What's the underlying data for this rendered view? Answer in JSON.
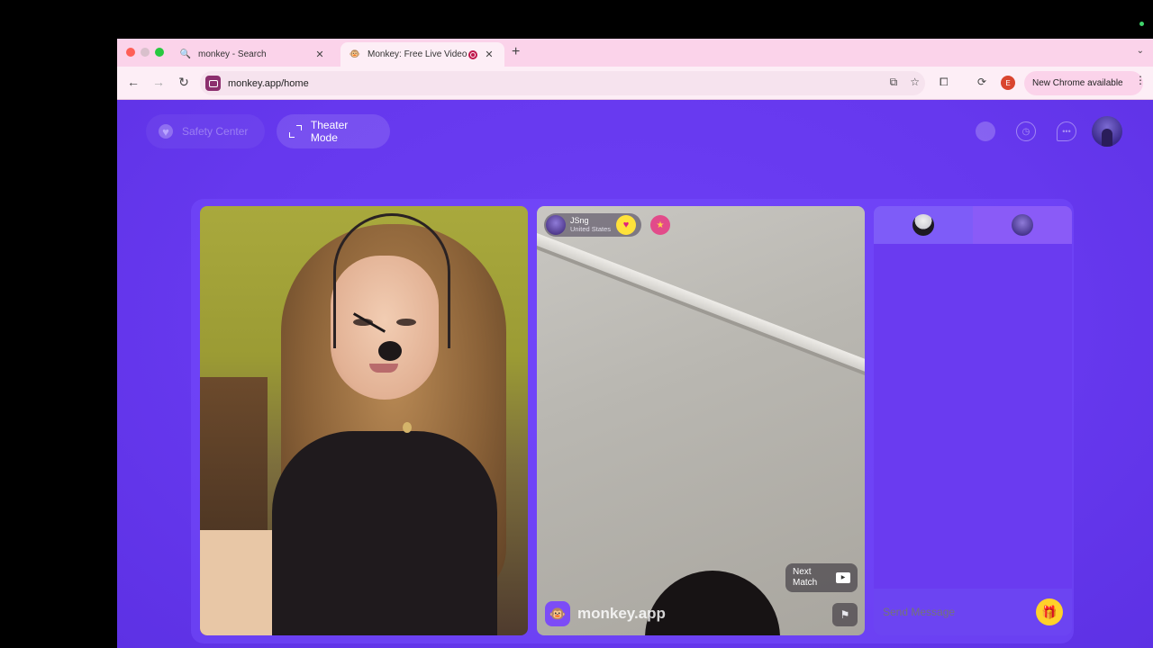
{
  "browser": {
    "tabs": [
      {
        "title": "monkey - Search",
        "icon": "search-icon"
      },
      {
        "title": "Monkey: Free Live Video Ch",
        "icon": "monkey-favicon"
      }
    ],
    "url": "monkey.app/home",
    "profile_initial": "E",
    "update_label": "New Chrome available"
  },
  "header": {
    "safety_center": "Safety Center",
    "theater_mode": "Theater Mode"
  },
  "partner": {
    "name": "JSng",
    "country": "United States",
    "next_match_line1": "Next",
    "next_match_line2": "Match",
    "brand": "monkey.app"
  },
  "chat": {
    "placeholder": "Send Message"
  },
  "colors": {
    "page_background": "#6a3df0",
    "tab_strip": "#fbd3ea",
    "gift_button": "#ffd12a"
  }
}
